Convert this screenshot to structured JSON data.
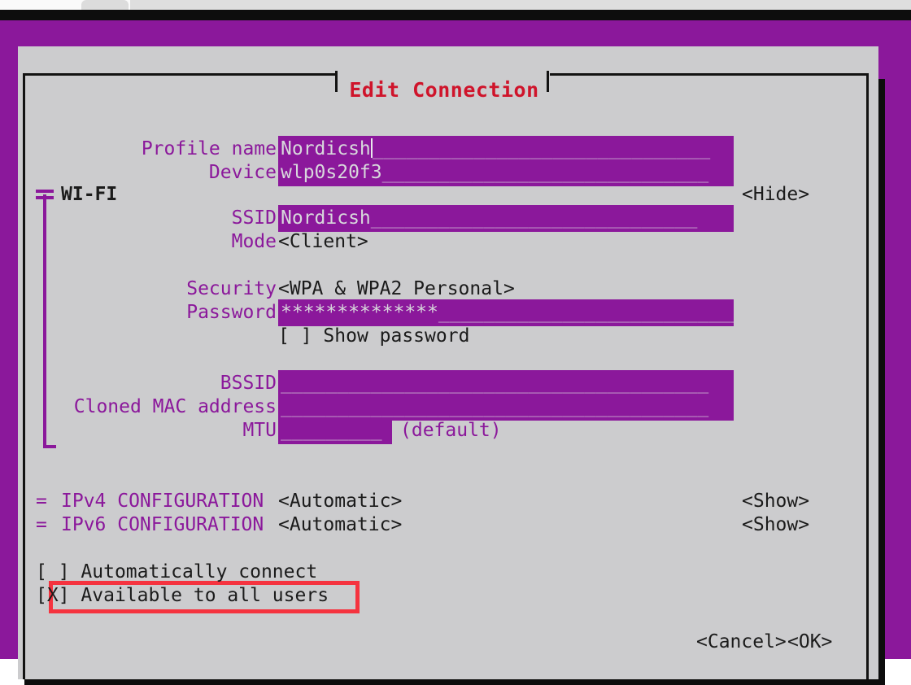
{
  "window": {
    "app": "nmtui",
    "dialog_title": "Edit Connection",
    "title_color": "#cf142b",
    "terminal_bg": "#8b189b",
    "dialog_bg": "#ccccce",
    "accent": "#8b189b",
    "highlight_color": "#f5333f"
  },
  "form": {
    "profile_name": {
      "label": "Profile name",
      "value": "Nordicsh",
      "placeholder": "______________________________",
      "focused": true
    },
    "device": {
      "label": "Device",
      "value": "wlp0s20f3",
      "placeholder": "_____________________________"
    }
  },
  "wifi_section": {
    "title": "WI-FI",
    "toggle_label": "<Hide>",
    "expanded": true,
    "ssid": {
      "label": "SSID",
      "value": "Nordicsh",
      "placeholder": "_____________________________"
    },
    "mode": {
      "label": "Mode",
      "value": "<Client>"
    },
    "security": {
      "label": "Security",
      "value": "<WPA & WPA2 Personal>"
    },
    "password": {
      "label": "Password",
      "value": "**************",
      "placeholder": "___________________________"
    },
    "show_password": {
      "checkbox": "[ ]",
      "label": "Show password",
      "checked": false
    },
    "bssid": {
      "label": "BSSID",
      "value": "",
      "placeholder": "______________________________________"
    },
    "cloned_mac": {
      "label": "Cloned MAC address",
      "value": "",
      "placeholder": "______________________________________"
    },
    "mtu": {
      "label": "MTU",
      "value": "",
      "placeholder": "_________",
      "suffix": "(default)"
    }
  },
  "ipv4": {
    "marker": "=",
    "label": "IPv4 CONFIGURATION",
    "value": "<Automatic>",
    "toggle_label": "<Show>"
  },
  "ipv6": {
    "marker": "=",
    "label": "IPv6 CONFIGURATION",
    "value": "<Automatic>",
    "toggle_label": "<Show>"
  },
  "options": {
    "auto_connect": {
      "checkbox": "[ ]",
      "label": "Automatically connect",
      "checked": false,
      "highlighted": true
    },
    "all_users": {
      "checkbox": "[X]",
      "label": "Available to all users",
      "checked": true
    }
  },
  "buttons": {
    "cancel": "<Cancel>",
    "ok": "<OK>"
  }
}
